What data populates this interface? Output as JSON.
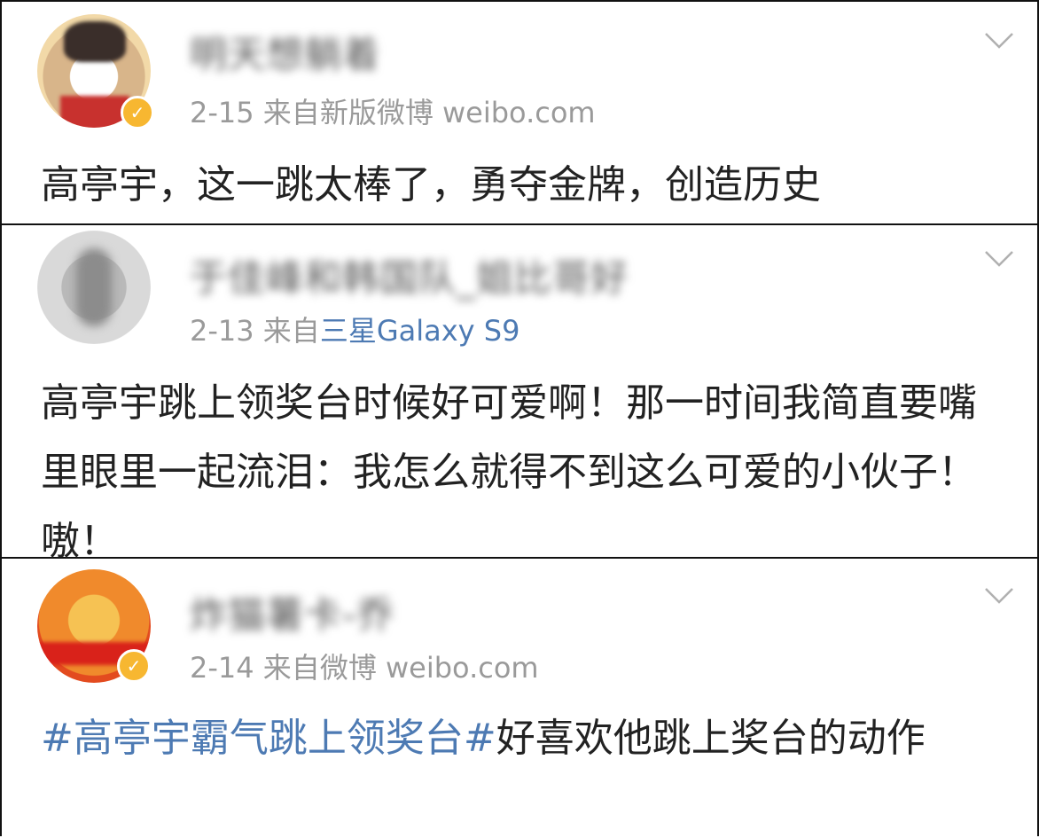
{
  "posts": [
    {
      "username": "明天想躺着",
      "date": "2-15",
      "source_prefix": "来自",
      "source": "新版微博 weibo.com",
      "content": "高亭宇，这一跳太棒了，勇夺金牌，创造历史",
      "verified": true
    },
    {
      "username": "于佳峰和韩国队_姐比哥好",
      "date": "2-13",
      "source_prefix": "来自",
      "source": "三星Galaxy S9",
      "content": "高亭宇跳上领奖台时候好可爱啊！那一时间我简直要嘴里眼里一起流泪：我怎么就得不到这么可爱的小伙子！嗷！",
      "verified": false
    },
    {
      "username": "炸猫薯卡-乔",
      "date": "2-14",
      "source_prefix": "来自",
      "source": "微博 weibo.com",
      "topic": "#高亭宇霸气跳上领奖台#",
      "content": "好喜欢他跳上奖台的动作",
      "verified": true
    }
  ],
  "icons": {
    "verified": "verified-badge-icon",
    "more": "chevron-down-icon"
  },
  "colors": {
    "link": "#4d7ab3",
    "badge": "#f7b731",
    "meta": "#9a9a9a",
    "text": "#222222"
  }
}
